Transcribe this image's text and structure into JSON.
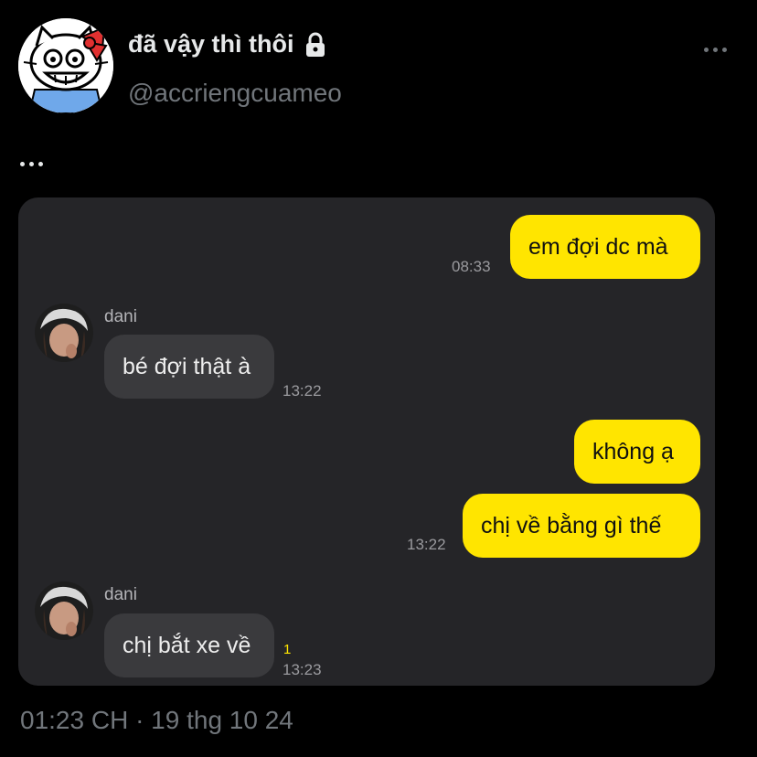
{
  "profile": {
    "display_name": "đã vậy thì thôi",
    "handle": "@accriengcuameo"
  },
  "tweet_text": "...",
  "chat": {
    "messages": [
      {
        "from": "me",
        "text": "em đợi dc mà",
        "time": "08:33"
      },
      {
        "from": "dani",
        "sender": "dani",
        "text": "bé đợi thật à",
        "time": "13:22"
      },
      {
        "from": "me",
        "text": "không ạ"
      },
      {
        "from": "me",
        "text": "chị về bằng gì thế",
        "time": "13:22"
      },
      {
        "from": "dani",
        "sender": "dani",
        "text": "chị bắt xe về",
        "time": "13:23",
        "unread": "1"
      }
    ]
  },
  "timestamp": "01:23 CH · 19 thg 10 24",
  "icons": [
    "avatar-cat-icon",
    "lock-icon",
    "more-icon"
  ],
  "colors": {
    "my_bubble": "#ffe500",
    "their_bubble": "#3a3a3d",
    "chat_bg": "#252528"
  }
}
